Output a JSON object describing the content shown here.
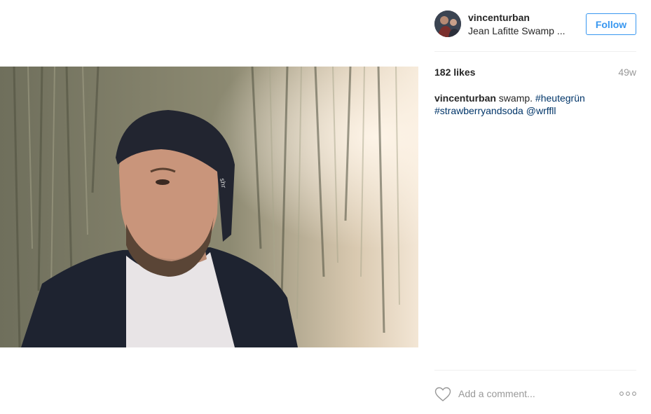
{
  "post": {
    "image_icon": "post-photo",
    "alt": "portrait photo"
  },
  "header": {
    "username": "vincenturban",
    "location": "Jean Lafitte Swamp ...",
    "follow_label": "Follow"
  },
  "meta": {
    "likes": "182 likes",
    "age": "49w"
  },
  "caption": {
    "user": "vincenturban",
    "text": " swamp. ",
    "tag1": "#heutegrün",
    "tag2": "#strawberryandsoda",
    "mention": "@wrffll"
  },
  "comment": {
    "placeholder": "Add a comment...",
    "heart_icon": "heart-outline",
    "more_icon": "ellipsis"
  },
  "colors": {
    "accent": "#3897f0",
    "hashtag": "#003569",
    "muted": "#999999",
    "divider": "#efefef"
  }
}
